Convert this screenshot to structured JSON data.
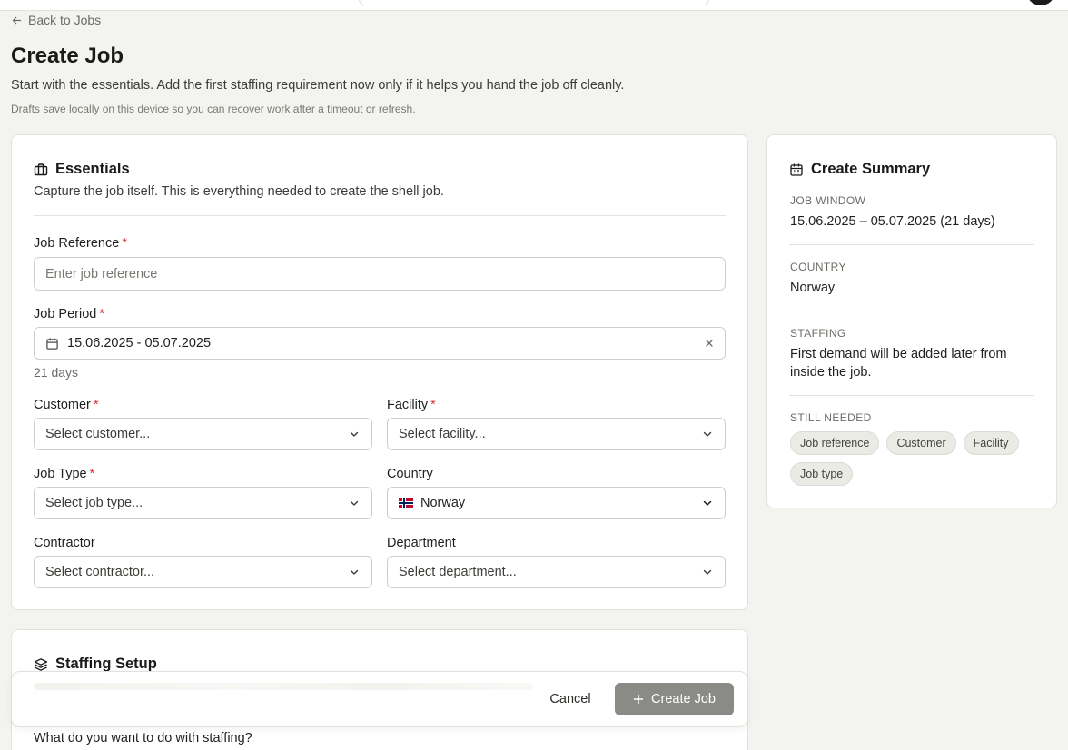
{
  "nav": {
    "back_label": "Back to Jobs"
  },
  "page": {
    "title": "Create Job",
    "subtitle": "Start with the essentials. Add the first staffing requirement now only if it helps you hand the job off cleanly.",
    "note": "Drafts save locally on this device so you can recover work after a timeout or refresh."
  },
  "essentials": {
    "title": "Essentials",
    "description": "Capture the job itself. This is everything needed to create the shell job.",
    "job_reference": {
      "label": "Job Reference",
      "placeholder": "Enter job reference"
    },
    "job_period": {
      "label": "Job Period",
      "value": "15.06.2025 - 05.07.2025",
      "days": "21 days"
    },
    "customer": {
      "label": "Customer",
      "value": "Select customer..."
    },
    "facility": {
      "label": "Facility",
      "value": "Select facility..."
    },
    "job_type": {
      "label": "Job Type",
      "value": "Select job type..."
    },
    "country": {
      "label": "Country",
      "value": "Norway",
      "flag": "norway-flag"
    },
    "contractor": {
      "label": "Contractor",
      "value": "Select contractor..."
    },
    "department": {
      "label": "Department",
      "value": "Select department..."
    },
    "required_marker": "*"
  },
  "staffing": {
    "title": "Staffing Setup",
    "question": "What do you want to do with staffing?"
  },
  "summary": {
    "title": "Create Summary",
    "job_window": {
      "label": "JOB WINDOW",
      "value": "15.06.2025 – 05.07.2025 (21 days)"
    },
    "country": {
      "label": "COUNTRY",
      "value": "Norway"
    },
    "staffing": {
      "label": "STAFFING",
      "value": "First demand will be added later from inside the job."
    },
    "still_needed": {
      "label": "STILL NEEDED",
      "items": [
        "Job reference",
        "Customer",
        "Facility",
        "Job type"
      ]
    }
  },
  "actions": {
    "cancel_label": "Cancel",
    "create_label": "Create Job"
  },
  "colors": {
    "required": "#d6303a",
    "create_button": "#8a8a86",
    "background": "#f3f3ef"
  }
}
